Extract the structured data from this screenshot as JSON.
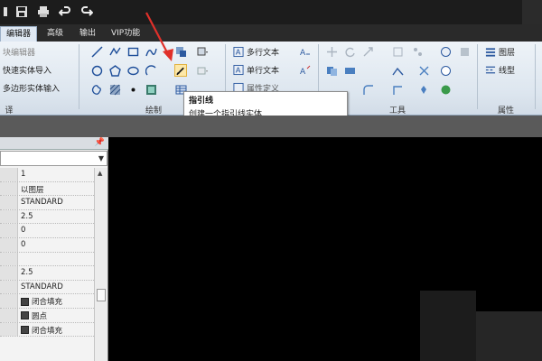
{
  "tabs": [
    {
      "label": "编辑器",
      "active": true
    },
    {
      "label": "高级",
      "active": false
    },
    {
      "label": "输出",
      "active": false
    },
    {
      "label": "VIP功能",
      "active": false
    }
  ],
  "ribbon": {
    "left": {
      "item1": "块编辑器",
      "item2": "快速实体导入",
      "item3": "多边形实体输入"
    },
    "draw_group_label": "绘制",
    "tools_group_label": "工具",
    "props_group_label": "属性",
    "text_items": {
      "mtext": "多行文本",
      "stext": "单行文本",
      "tthird": "属性定义"
    },
    "props_items": {
      "layer": "图层",
      "linetype": "线型"
    },
    "left_group_label_partial": "译"
  },
  "tooltip": {
    "title": "指引线",
    "description": "创建一个指引线实体"
  },
  "panel": {
    "pin": "📌",
    "rows": [
      {
        "value": "1"
      },
      {
        "value": "以图层"
      },
      {
        "value": "STANDARD"
      },
      {
        "value": "2.5"
      },
      {
        "value": "0"
      },
      {
        "value": "0"
      },
      {
        "value": ""
      },
      {
        "value": "2.5"
      },
      {
        "value": "STANDARD"
      },
      {
        "value": "闭合填充",
        "icon": true
      },
      {
        "value": "圆点",
        "icon": true
      },
      {
        "value": "闭合填充",
        "icon": true
      }
    ]
  },
  "colors": {
    "arrow": "#e0302a",
    "ribbon_bg": "#dde6ef",
    "canvas": "#000000"
  }
}
